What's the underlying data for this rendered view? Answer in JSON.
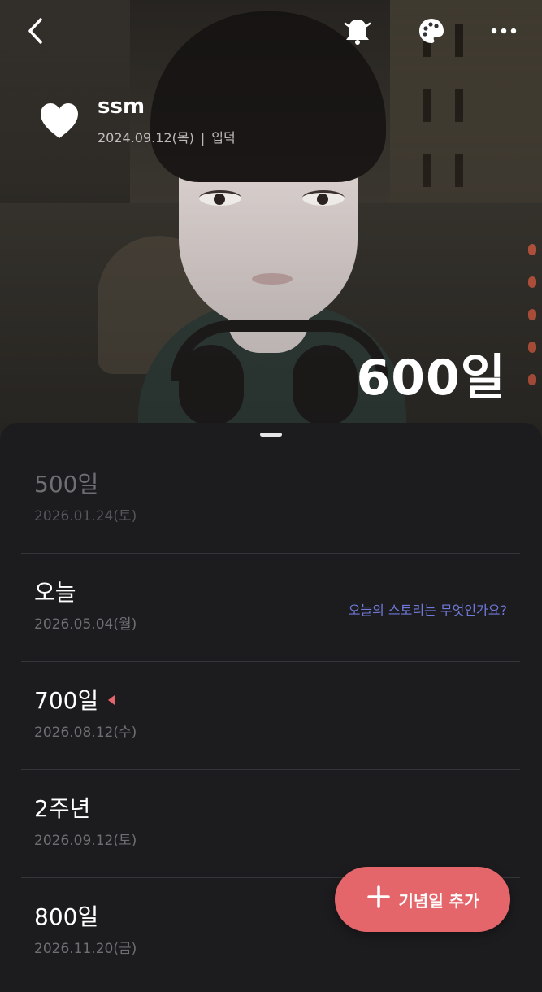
{
  "header": {
    "back_icon": "chevron-left-icon",
    "notification_icon": "bell-icon",
    "palette_icon": "palette-icon",
    "more_icon": "more-horizontal-icon"
  },
  "profile": {
    "name": "ssm",
    "date": "2024.09.12(목)",
    "separator": "|",
    "status": "입덕",
    "heart_icon": "heart-icon"
  },
  "hero": {
    "days": "600일"
  },
  "list": {
    "items": [
      {
        "title": "500일",
        "date": "2026.01.24(토)",
        "past": true
      },
      {
        "title": "오늘",
        "date": "2026.05.04(월)",
        "prompt": "오늘의 스토리는 무엇인가요?"
      },
      {
        "title": "700일",
        "date": "2026.08.12(수)",
        "marker_icon": "triangle-marker-icon"
      },
      {
        "title": "2주년",
        "date": "2026.09.12(토)"
      },
      {
        "title": "800일",
        "date": "2026.11.20(금)"
      }
    ]
  },
  "fab": {
    "label": "기념일 추가",
    "icon": "plus-icon"
  },
  "colors": {
    "accent": "#e4666b",
    "prompt": "#6f79d8",
    "sheet": "#1c1c1f"
  }
}
